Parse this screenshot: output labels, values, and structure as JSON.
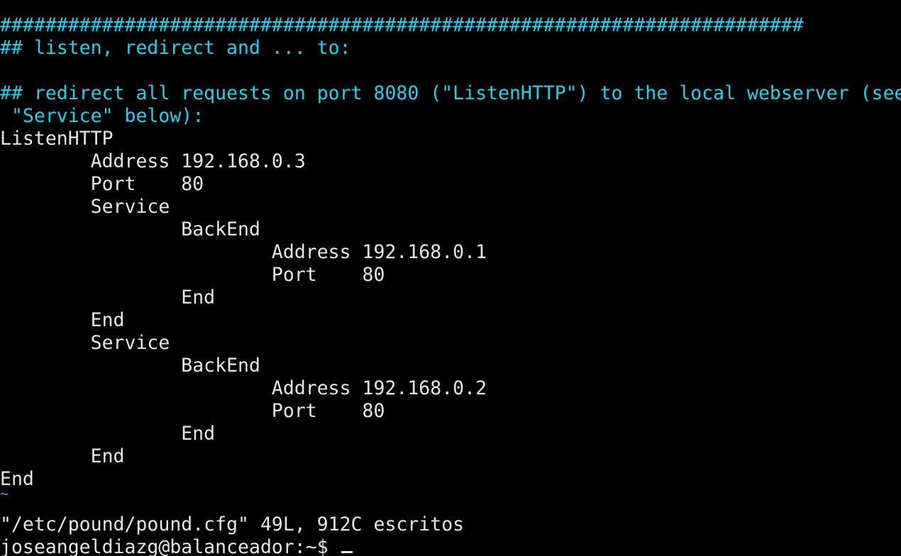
{
  "terminal": {
    "colors": {
      "background": "#000000",
      "comment": "#17d5f0",
      "text": "#e6e6e6",
      "tilde": "#1aa6e0"
    },
    "lines": [
      "#######################################################################",
      "## listen, redirect and ... to:",
      "",
      "## redirect all requests on port 8080 (\"ListenHTTP\") to the local webserver (see",
      " \"Service\" below):",
      "ListenHTTP",
      "        Address 192.168.0.3",
      "        Port    80",
      "        Service",
      "                BackEnd",
      "                        Address 192.168.0.1",
      "                        Port    80",
      "                End",
      "        End",
      "        Service",
      "                BackEnd",
      "                        Address 192.168.0.2",
      "                        Port    80",
      "                End",
      "        End",
      "End",
      "~"
    ],
    "status_message": "\"/etc/pound/pound.cfg\" 49L, 912C escritos",
    "prompt": "joseangeldiazg@balanceador:~$"
  }
}
